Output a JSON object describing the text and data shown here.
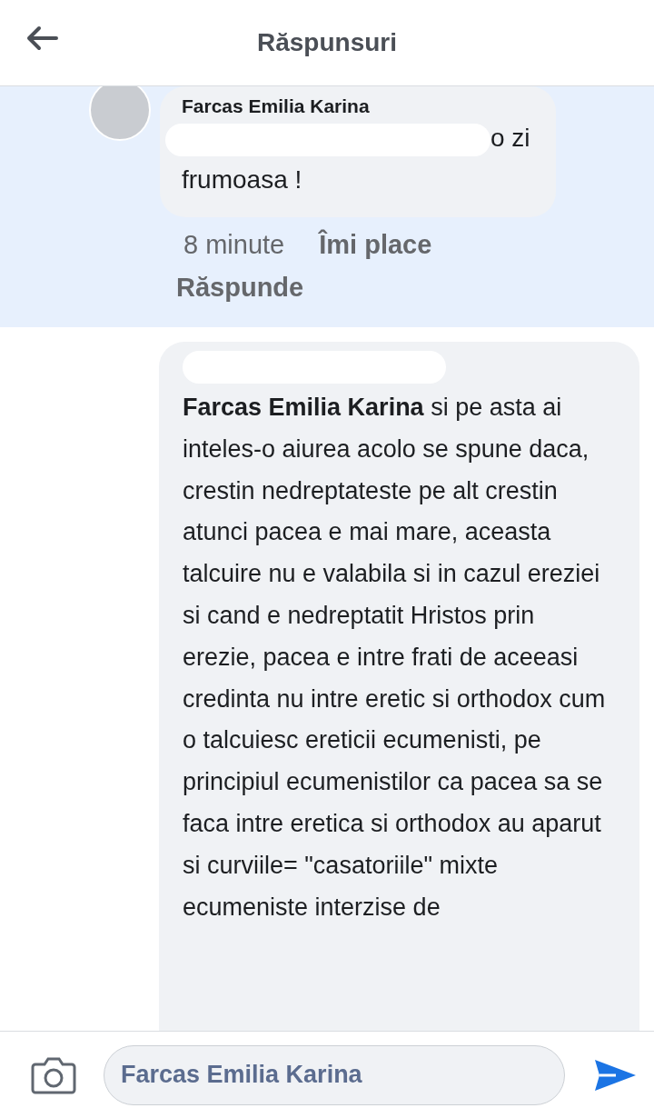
{
  "header": {
    "title": "Răspunsuri"
  },
  "comment": {
    "author": "Farcas Emilia Karina",
    "text": "o zi frumoasa !",
    "redacted": true,
    "highlighted": true,
    "time": "8 minute",
    "like": "Îmi place",
    "reply": "Răspunde"
  },
  "reply": {
    "redacted": true,
    "mention": "Farcas Emilia Karina",
    "text": "si pe asta ai inteles-o aiurea acolo se spune daca, crestin nedreptateste pe alt crestin atunci pacea e mai mare, aceasta talcuire nu e valabila si in cazul ereziei si cand e nedreptatit Hristos prin erezie, pacea e intre frati de aceeasi credinta nu intre eretic si orthodox cum o talcuiesc ereticii ecumenisti, pe principiul ecumenistilor ca pacea sa se faca intre eretica si orthodox au aparut si curviile= \"casatoriile\" mixte ecumeniste interzise de"
  },
  "composer": {
    "value": "Farcas Emilia Karina"
  }
}
